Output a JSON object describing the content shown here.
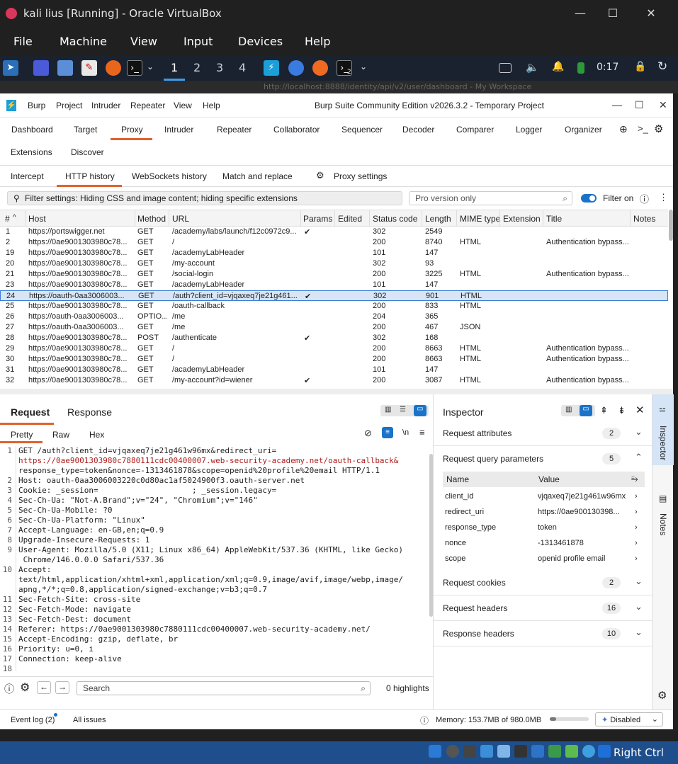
{
  "vbox": {
    "title": "kali lius [Running] - Oracle VirtualBox",
    "menu": [
      "File",
      "Machine",
      "View",
      "Input",
      "Devices",
      "Help"
    ],
    "host_key": "Right Ctrl"
  },
  "kali": {
    "workspaces": [
      "1",
      "2",
      "3",
      "4"
    ],
    "clock": "0:17",
    "terminal_badge": "2",
    "firefox_tab_partial": "http://localhost:8888/identity/api/v2/user/dashboard - My Workspace"
  },
  "burp": {
    "menu": [
      "Burp",
      "Project",
      "Intruder",
      "Repeater",
      "View",
      "Help"
    ],
    "title": "Burp Suite Community Edition v2026.3.2 - Temporary Project",
    "tabs_row1": [
      "Dashboard",
      "Target",
      "Proxy",
      "Intruder",
      "Repeater",
      "Collaborator",
      "Sequencer",
      "Decoder",
      "Comparer",
      "Logger",
      "Organizer"
    ],
    "tabs_row2": [
      "Extensions",
      "Discover"
    ],
    "subtabs": [
      "Intercept",
      "HTTP history",
      "WebSockets history",
      "Match and replace",
      "Proxy settings"
    ],
    "filter_text": "Filter settings: Hiding CSS and image content; hiding specific extensions",
    "pro_placeholder": "Pro version only",
    "filter_on_label": "Filter on",
    "columns": [
      "#",
      "Host",
      "Method",
      "URL",
      "Params",
      "Edited",
      "Status code",
      "Length",
      "MIME type",
      "Extension",
      "Title",
      "Notes"
    ],
    "rows": [
      {
        "id": "1",
        "host": "https://portswigger.net",
        "method": "GET",
        "url": "/academy/labs/launch/f12c0972c9...",
        "params": "✔",
        "status": "302",
        "length": "2549",
        "mime": "",
        "title": ""
      },
      {
        "id": "2",
        "host": "https://0ae9001303980c78...",
        "method": "GET",
        "url": "/",
        "params": "",
        "status": "200",
        "length": "8740",
        "mime": "HTML",
        "title": "Authentication bypass..."
      },
      {
        "id": "19",
        "host": "https://0ae9001303980c78...",
        "method": "GET",
        "url": "/academyLabHeader",
        "params": "",
        "status": "101",
        "length": "147",
        "mime": "",
        "title": ""
      },
      {
        "id": "20",
        "host": "https://0ae9001303980c78...",
        "method": "GET",
        "url": "/my-account",
        "params": "",
        "status": "302",
        "length": "93",
        "mime": "",
        "title": ""
      },
      {
        "id": "21",
        "host": "https://0ae9001303980c78...",
        "method": "GET",
        "url": "/social-login",
        "params": "",
        "status": "200",
        "length": "3225",
        "mime": "HTML",
        "title": "Authentication bypass..."
      },
      {
        "id": "23",
        "host": "https://0ae9001303980c78...",
        "method": "GET",
        "url": "/academyLabHeader",
        "params": "",
        "status": "101",
        "length": "147",
        "mime": "",
        "title": ""
      },
      {
        "id": "24",
        "host": "https://oauth-0aa3006003...",
        "method": "GET",
        "url": "/auth?client_id=vjqaxeq7je21g461...",
        "params": "✔",
        "status": "302",
        "length": "901",
        "mime": "HTML",
        "title": ""
      },
      {
        "id": "25",
        "host": "https://0ae9001303980c78...",
        "method": "GET",
        "url": "/oauth-callback",
        "params": "",
        "status": "200",
        "length": "833",
        "mime": "HTML",
        "title": ""
      },
      {
        "id": "26",
        "host": "https://oauth-0aa3006003...",
        "method": "OPTIO...",
        "url": "/me",
        "params": "",
        "status": "204",
        "length": "365",
        "mime": "",
        "title": ""
      },
      {
        "id": "27",
        "host": "https://oauth-0aa3006003...",
        "method": "GET",
        "url": "/me",
        "params": "",
        "status": "200",
        "length": "467",
        "mime": "JSON",
        "title": ""
      },
      {
        "id": "28",
        "host": "https://0ae9001303980c78...",
        "method": "POST",
        "url": "/authenticate",
        "params": "✔",
        "status": "302",
        "length": "168",
        "mime": "",
        "title": ""
      },
      {
        "id": "29",
        "host": "https://0ae9001303980c78...",
        "method": "GET",
        "url": "/",
        "params": "",
        "status": "200",
        "length": "8663",
        "mime": "HTML",
        "title": "Authentication bypass..."
      },
      {
        "id": "30",
        "host": "https://0ae9001303980c78...",
        "method": "GET",
        "url": "/",
        "params": "",
        "status": "200",
        "length": "8663",
        "mime": "HTML",
        "title": "Authentication bypass..."
      },
      {
        "id": "31",
        "host": "https://0ae9001303980c78...",
        "method": "GET",
        "url": "/academyLabHeader",
        "params": "",
        "status": "101",
        "length": "147",
        "mime": "",
        "title": ""
      },
      {
        "id": "32",
        "host": "https://0ae9001303980c78...",
        "method": "GET",
        "url": "/my-account?id=wiener",
        "params": "✔",
        "status": "200",
        "length": "3087",
        "mime": "HTML",
        "title": "Authentication bypass..."
      }
    ],
    "selected_row": "24",
    "req_tabs": [
      "Request",
      "Response"
    ],
    "view_tabs": [
      "Pretty",
      "Raw",
      "Hex"
    ],
    "request_lines": [
      "GET /auth?client_id=vjqaxeq7je21g461w96mx&redirect_uri=",
      "https://0ae9001303980c7880111cdc00400007.web-security-academy.net/oauth-callback&",
      "response_type=token&nonce=-1313461878&scope=openid%20profile%20email HTTP/1.1",
      "Host: oauth-0aa3006003220c0d80ac1af5024900f3.oauth-server.net",
      "Cookie: _session=                    ; _session.legacy=",
      "Sec-Ch-Ua: \"Not-A.Brand\";v=\"24\", \"Chromium\";v=\"146\"",
      "Sec-Ch-Ua-Mobile: ?0",
      "Sec-Ch-Ua-Platform: \"Linux\"",
      "Accept-Language: en-GB,en;q=0.9",
      "Upgrade-Insecure-Requests: 1",
      "User-Agent: Mozilla/5.0 (X11; Linux x86_64) AppleWebKit/537.36 (KHTML, like Gecko)",
      " Chrome/146.0.0.0 Safari/537.36",
      "Accept:",
      "text/html,application/xhtml+xml,application/xml;q=0.9,image/avif,image/webp,image/",
      "apng,*/*;q=0.8,application/signed-exchange;v=b3;q=0.7",
      "Sec-Fetch-Site: cross-site",
      "Sec-Fetch-Mode: navigate",
      "Sec-Fetch-Dest: document",
      "Referer: https://0ae9001303980c7880111cdc00400007.web-security-academy.net/",
      "Accept-Encoding: gzip, deflate, br",
      "Priority: u=0, i",
      "Connection: keep-alive",
      ""
    ],
    "line_numbers": [
      "1",
      "",
      "",
      "2",
      "3",
      "4",
      "5",
      "6",
      "7",
      "8",
      "9",
      "",
      "10",
      "",
      "",
      "11",
      "12",
      "13",
      "14",
      "15",
      "16",
      "17",
      "18"
    ],
    "search_placeholder": "Search",
    "highlights": "0 highlights",
    "inspector": {
      "title": "Inspector",
      "sections": [
        {
          "label": "Request attributes",
          "count": "2"
        },
        {
          "label": "Request query parameters",
          "count": "5"
        },
        {
          "label": "Request cookies",
          "count": "2"
        },
        {
          "label": "Request headers",
          "count": "16"
        },
        {
          "label": "Response headers",
          "count": "10"
        }
      ],
      "param_head": [
        "Name",
        "Value"
      ],
      "params": [
        {
          "name": "client_id",
          "value": "vjqaxeq7je21g461w96mx"
        },
        {
          "name": "redirect_uri",
          "value": "https://0ae900130398..."
        },
        {
          "name": "response_type",
          "value": "token"
        },
        {
          "name": "nonce",
          "value": "-1313461878"
        },
        {
          "name": "scope",
          "value": "openid profile email"
        }
      ]
    },
    "side_tabs": [
      "Inspector",
      "Notes"
    ],
    "status": {
      "event_log": "Event log (2)",
      "all_issues": "All issues",
      "memory": "Memory: 153.7MB of 980.0MB",
      "memory_fraction": 0.16,
      "mode": "Disabled"
    }
  }
}
